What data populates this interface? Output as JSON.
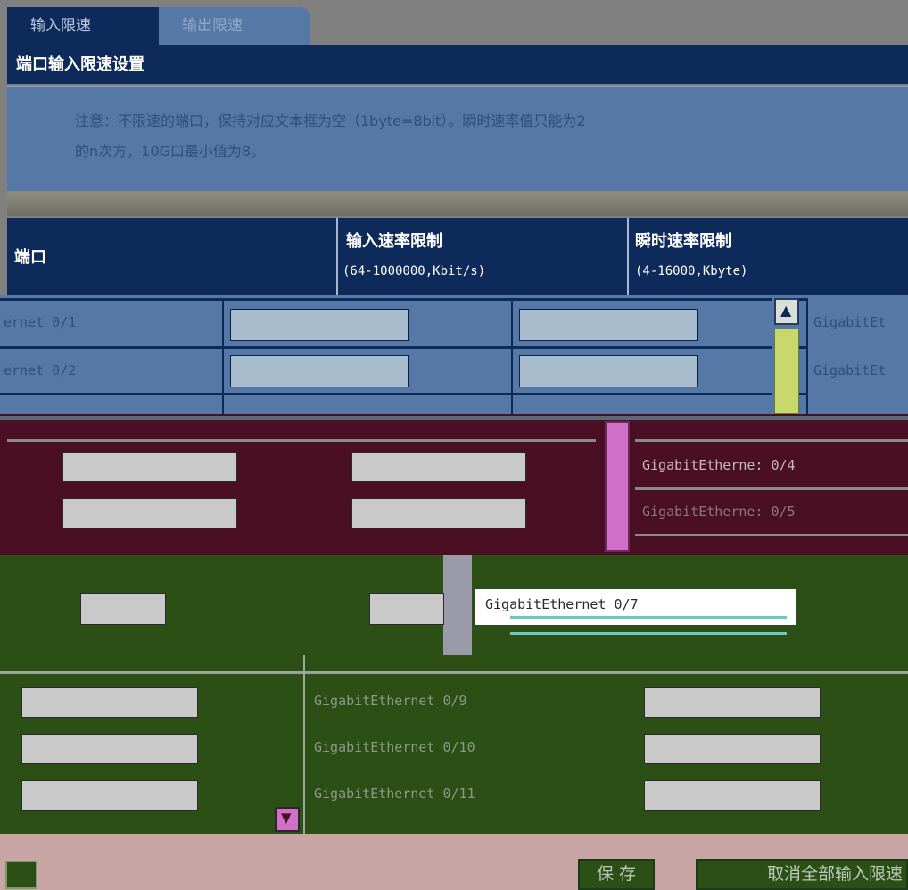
{
  "tabs": [
    {
      "label": "输入限速"
    },
    {
      "label": "输出限速"
    }
  ],
  "section_title": "端口输入限速设置",
  "notice": {
    "line1": "注意：不限速的端口，保持对应文本框为空（1byte=8bit）。瞬时速率值只能为2",
    "line2": "的n次方，10G口最小值为8。"
  },
  "table": {
    "headers": {
      "port": "端口",
      "input_rate": "输入速率限制",
      "input_rate_unit": "(64-1000000,Kbit/s)",
      "burst_rate": "瞬时速率限制",
      "burst_rate_unit": "(4-16000,Kbyte)"
    },
    "rows": [
      {
        "port": "ernet 0/1"
      },
      {
        "port": "ernet 0/2"
      },
      {
        "port": "GigabitEtherne: 0/4"
      },
      {
        "port": "GigabitEtherne: 0/5"
      },
      {
        "port": "GigabitEthernet 0/7"
      },
      {
        "port": "GigabitEthernet 0/9"
      },
      {
        "port": "GigabitEthernet 0/10"
      },
      {
        "port": "GigabitEthernet 0/11"
      }
    ],
    "side_ports": [
      "GigabitEt",
      "GigabitEt"
    ]
  },
  "buttons": {
    "save": "保 存",
    "cancel_all": "取消全部输入限速"
  },
  "colors": {
    "header_navy": "#0e2a5a",
    "notice_blue": "#5678a6",
    "maroon": "#4a0f22",
    "green": "#2c4f15",
    "footer_pink": "#c9a6a6"
  }
}
